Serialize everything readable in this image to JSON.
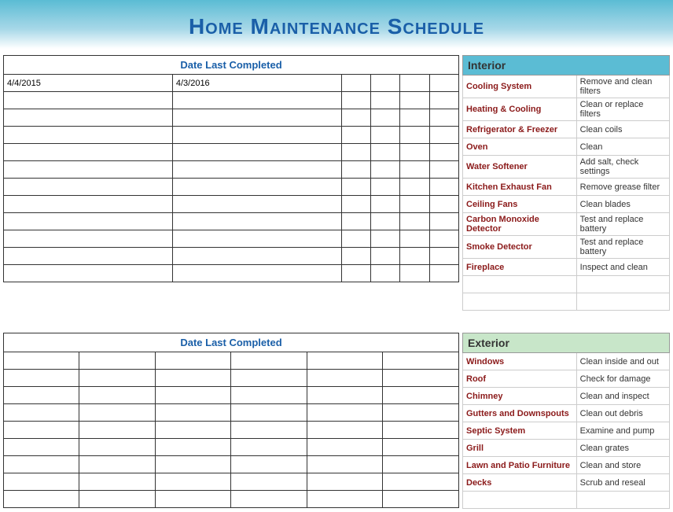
{
  "header": {
    "title": "Home Maintenance Schedule"
  },
  "interior": {
    "section_label": "Interior",
    "date_label": "Date Last Completed",
    "dates": [
      [
        "4/4/2015",
        "4/3/2016",
        "",
        "",
        "",
        ""
      ],
      [
        "",
        "",
        "",
        "",
        "",
        ""
      ],
      [
        "",
        "",
        "",
        "",
        "",
        ""
      ],
      [
        "",
        "",
        "",
        "",
        "",
        ""
      ],
      [
        "",
        "",
        "",
        "",
        "",
        ""
      ],
      [
        "",
        "",
        "",
        "",
        "",
        ""
      ],
      [
        "",
        "",
        "",
        "",
        "",
        ""
      ],
      [
        "",
        "",
        "",
        "",
        "",
        ""
      ],
      [
        "",
        "",
        "",
        "",
        "",
        ""
      ],
      [
        "",
        "",
        "",
        "",
        "",
        ""
      ],
      [
        "",
        "",
        "",
        "",
        "",
        ""
      ],
      [
        "",
        "",
        "",
        "",
        "",
        ""
      ]
    ],
    "items": [
      {
        "name": "Cooling System",
        "action": "Remove and clean filters"
      },
      {
        "name": "Heating & Cooling",
        "action": "Clean or replace filters"
      },
      {
        "name": "Refrigerator & Freezer",
        "action": "Clean coils"
      },
      {
        "name": "Oven",
        "action": "Clean"
      },
      {
        "name": "Water Softener",
        "action": "Add salt, check settings"
      },
      {
        "name": "Kitchen Exhaust Fan",
        "action": "Remove grease filter"
      },
      {
        "name": "Ceiling Fans",
        "action": "Clean blades"
      },
      {
        "name": "Carbon Monoxide Detector",
        "action": "Test and replace battery"
      },
      {
        "name": "Smoke Detector",
        "action": "Test and replace battery"
      },
      {
        "name": "Fireplace",
        "action": "Inspect and clean"
      },
      {
        "name": "",
        "action": ""
      },
      {
        "name": "",
        "action": ""
      }
    ]
  },
  "exterior": {
    "section_label": "Exterior",
    "date_label": "Date Last Completed",
    "dates": [
      [
        "",
        "",
        "",
        "",
        "",
        ""
      ],
      [
        "",
        "",
        "",
        "",
        "",
        ""
      ],
      [
        "",
        "",
        "",
        "",
        "",
        ""
      ],
      [
        "",
        "",
        "",
        "",
        "",
        ""
      ],
      [
        "",
        "",
        "",
        "",
        "",
        ""
      ],
      [
        "",
        "",
        "",
        "",
        "",
        ""
      ],
      [
        "",
        "",
        "",
        "",
        "",
        ""
      ],
      [
        "",
        "",
        "",
        "",
        "",
        ""
      ],
      [
        "",
        "",
        "",
        "",
        "",
        ""
      ]
    ],
    "items": [
      {
        "name": "Windows",
        "action": "Clean inside and out"
      },
      {
        "name": "Roof",
        "action": "Check for damage"
      },
      {
        "name": "Chimney",
        "action": "Clean and inspect"
      },
      {
        "name": "Gutters and Downspouts",
        "action": "Clean out debris"
      },
      {
        "name": "Septic System",
        "action": "Examine and pump"
      },
      {
        "name": "Grill",
        "action": "Clean grates"
      },
      {
        "name": "Lawn and Patio Furniture",
        "action": "Clean and store"
      },
      {
        "name": "Decks",
        "action": "Scrub and reseal"
      },
      {
        "name": "",
        "action": ""
      }
    ]
  }
}
